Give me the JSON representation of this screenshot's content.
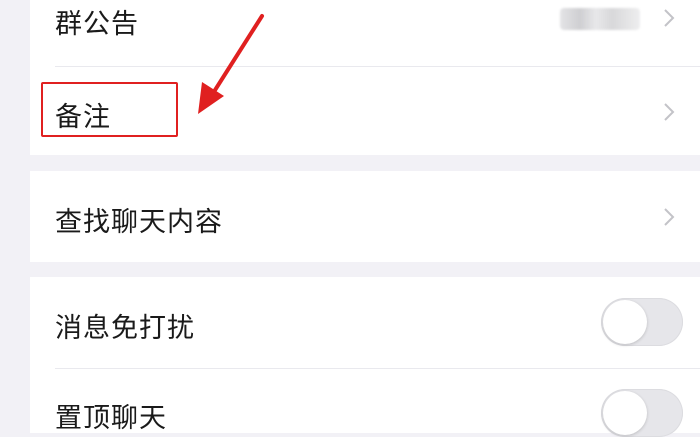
{
  "settings": {
    "group_notice": {
      "label": "群公告"
    },
    "remark": {
      "label": "备注"
    },
    "search_chat": {
      "label": "查找聊天内容"
    },
    "mute": {
      "label": "消息免打扰",
      "enabled": false
    },
    "pin": {
      "label": "置顶聊天",
      "enabled": false
    }
  },
  "icons": {
    "chevron": "chevron-right-icon",
    "arrow": "arrow-annotation-icon"
  },
  "colors": {
    "background": "#f2f1f6",
    "row": "#ffffff",
    "annotation": "#e02020",
    "text": "#1a1a1a",
    "chevron": "#c3c3c8"
  }
}
